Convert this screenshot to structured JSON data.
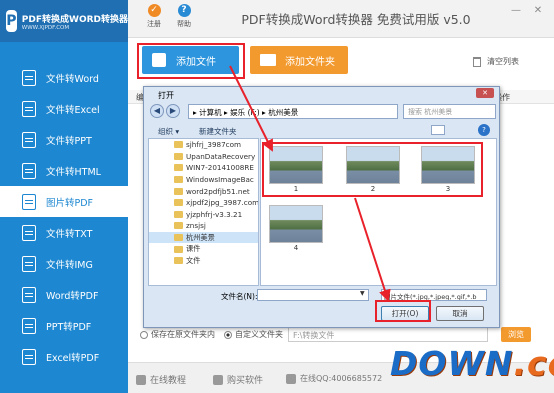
{
  "logo": {
    "title": "PDF转换成WORD转换器",
    "url": "WWW.XJPDF.COM",
    "mark": "P"
  },
  "sidebar": {
    "items": [
      {
        "label": "文件转Word"
      },
      {
        "label": "文件转Excel"
      },
      {
        "label": "文件转PPT"
      },
      {
        "label": "文件转HTML"
      },
      {
        "label": "图片转PDF"
      },
      {
        "label": "文件转TXT"
      },
      {
        "label": "文件转IMG"
      },
      {
        "label": "Word转PDF"
      },
      {
        "label": "PPT转PDF"
      },
      {
        "label": "Excel转PDF"
      }
    ],
    "active_index": 4
  },
  "topbar": {
    "register": "注册",
    "help": "帮助",
    "title": "PDF转换成Word转换器 免费试用版 v5.0",
    "minimize": "—",
    "close": "✕"
  },
  "toolbar": {
    "add_file": "添加文件",
    "add_folder": "添加文件夹",
    "clear_list": "清空列表"
  },
  "list": {
    "col_name": "编",
    "col_op": "操作"
  },
  "output": {
    "option1": "保存在原文件夹内",
    "option2": "自定义文件夹",
    "path_placeholder": "F:\\转换文件",
    "browse": "浏览"
  },
  "bottombar": {
    "tutorial": "在线教程",
    "buy": "购买软件",
    "qq": "在线QQ:4006685572"
  },
  "watermark": {
    "main": "DOWN",
    "suffix": ".cc"
  },
  "dialog": {
    "title": "打开",
    "address": "▸ 计算机 ▸ 娱乐 (F:) ▸ 杭州美景",
    "search_placeholder": "搜索 杭州美景",
    "organize": "组织 ▾",
    "new_folder": "新建文件夹",
    "help": "?",
    "back": "◀",
    "forward": "▶",
    "close": "✕",
    "tree": [
      {
        "label": "sjhfrj_3987com"
      },
      {
        "label": "UpanDataRecovery"
      },
      {
        "label": "WIN7-20141008RE"
      },
      {
        "label": "WindowsImageBac"
      },
      {
        "label": "word2pdfjb51.net"
      },
      {
        "label": "xjpdf2jpg_3987.com"
      },
      {
        "label": "yjzphfrj-v3.3.21"
      },
      {
        "label": "znsjsj"
      },
      {
        "label": "杭州美景"
      },
      {
        "label": "课件"
      },
      {
        "label": "文件"
      }
    ],
    "tree_selected": 8,
    "files": [
      {
        "label": "1"
      },
      {
        "label": "2"
      },
      {
        "label": "3"
      },
      {
        "label": "4"
      }
    ],
    "filename_label": "文件名(N):",
    "filetype": "图片文件(*.jpg,*.jpeg,*.gif,*.b",
    "open": "打开(O)",
    "cancel": "取消"
  },
  "colors": {
    "sidebar": "#1d87d1",
    "accent_orange": "#f39a2f",
    "highlight": "#e8212a"
  }
}
